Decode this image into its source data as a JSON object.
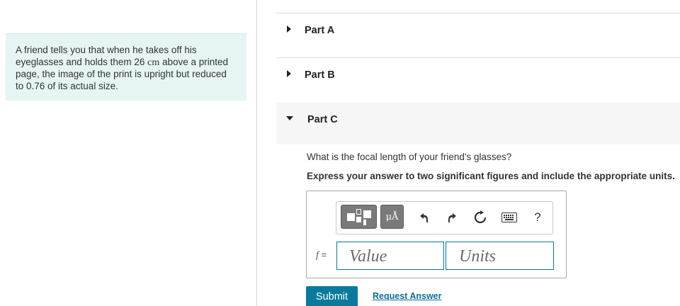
{
  "problem": {
    "text_before": "A friend tells you that when he takes off his eyeglasses and holds them 26 ",
    "unit_cm": "cm",
    "text_after": " above a printed page, the image of the print is upright but reduced to 0.76 of its actual size."
  },
  "parts": [
    {
      "label": "Part A",
      "expanded": false
    },
    {
      "label": "Part B",
      "expanded": false
    },
    {
      "label": "Part C",
      "expanded": true
    }
  ],
  "part_c": {
    "question": "What is the focal length of your friend's glasses?",
    "instruction": "Express your answer to two significant figures and include the appropriate units.",
    "toolbar": {
      "units_label": "μÅ",
      "icons": [
        "templates-icon",
        "units-icon",
        "undo-icon",
        "redo-icon",
        "reset-icon",
        "keyboard-icon",
        "help-icon"
      ],
      "help_label": "?"
    },
    "variable_label": "f",
    "equals": "=",
    "value_placeholder": "Value",
    "units_placeholder": "Units",
    "submit_label": "Submit",
    "request_label": "Request Answer"
  },
  "colors": {
    "intro_bg": "#e6f4f4",
    "accent": "#0a7a9c",
    "toolbar_button": "#7a7a7a"
  }
}
